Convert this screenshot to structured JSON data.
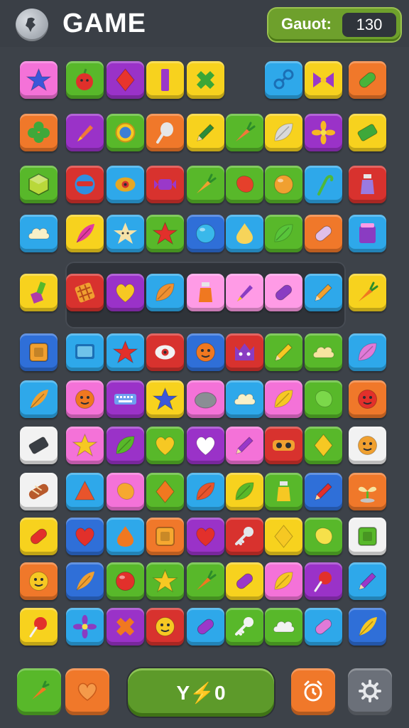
{
  "header": {
    "title": "GAME",
    "score_label": "Gauot:",
    "score_value": "130",
    "globe_icon": "globe-icon"
  },
  "colors": {
    "pink": "#f472d8",
    "green": "#58b82a",
    "purple": "#9a32c8",
    "yellow": "#f7d21e",
    "sky": "#2ea8ea",
    "orange": "#f0782a",
    "red": "#d8322e",
    "white": "#f2f2f2",
    "blue": "#2f6fd8",
    "lightpink": "#ff9be6"
  },
  "grid": {
    "rows": [
      [
        {
          "c": "pink",
          "icon": "star",
          "ic": "#3b57d9"
        },
        {
          "c": "green",
          "icon": "apple",
          "ic": "#e0302b"
        },
        {
          "c": "purple",
          "icon": "diamond",
          "ic": "#e8342c"
        },
        {
          "c": "yellow",
          "icon": "bar",
          "ic": "#9a38c9"
        },
        {
          "c": "yellow",
          "icon": "cross",
          "ic": "#3aa637"
        },
        {
          "c": "none"
        },
        {
          "c": "sky",
          "icon": "chain",
          "ic": "#1b6fb5"
        },
        {
          "c": "yellow",
          "icon": "bowtie",
          "ic": "#9a38c9"
        },
        {
          "c": "orange",
          "icon": "capsule",
          "ic": "#48b33a"
        }
      ],
      [
        {
          "c": "orange",
          "icon": "clover",
          "ic": "#3fa83a"
        },
        {
          "c": "purple",
          "icon": "brush",
          "ic": "#f0783a"
        },
        {
          "c": "green",
          "icon": "coin",
          "ic": "#3c7fd6"
        },
        {
          "c": "orange",
          "icon": "spoon",
          "ic": "#e6e6e6"
        },
        {
          "c": "yellow",
          "icon": "pencil",
          "ic": "#2c8c3a"
        },
        {
          "c": "green",
          "icon": "carrot",
          "ic": "#f0783a"
        },
        {
          "c": "yellow",
          "icon": "leaf",
          "ic": "#d9d9d9"
        },
        {
          "c": "purple",
          "icon": "flower",
          "ic": "#f6b823"
        },
        {
          "c": "yellow",
          "icon": "eraser",
          "ic": "#3fa83a"
        }
      ],
      [
        {
          "c": "green",
          "icon": "cube",
          "ic": "#b9d83a"
        },
        {
          "c": "red",
          "icon": "mask",
          "ic": "#2f8fe0"
        },
        {
          "c": "sky",
          "icon": "eye",
          "ic": "#e5a724"
        },
        {
          "c": "red",
          "icon": "candy",
          "ic": "#9a38c9"
        },
        {
          "c": "green",
          "icon": "carrot",
          "ic": "#f0a030"
        },
        {
          "c": "green",
          "icon": "blob",
          "ic": "#e5402b"
        },
        {
          "c": "green",
          "icon": "ball",
          "ic": "#f0a030"
        },
        {
          "c": "sky",
          "icon": "cane",
          "ic": "#4fb83a"
        },
        {
          "c": "red",
          "icon": "bottle",
          "ic": "#9a7ae0"
        }
      ],
      [
        {
          "c": "sky",
          "icon": "cloud",
          "ic": "#f8f0c8"
        },
        {
          "c": "yellow",
          "icon": "feather",
          "ic": "#e23aa0"
        },
        {
          "c": "sky",
          "icon": "starface",
          "ic": "#f5e2a8"
        },
        {
          "c": "green",
          "icon": "star",
          "ic": "#e2302b"
        },
        {
          "c": "blue",
          "icon": "ball",
          "ic": "#39b8ea"
        },
        {
          "c": "sky",
          "icon": "drop",
          "ic": "#f6d45a"
        },
        {
          "c": "green",
          "icon": "leaf",
          "ic": "#58c53a"
        },
        {
          "c": "orange",
          "icon": "capsule",
          "ic": "#e0bfe8"
        },
        {
          "c": "sky",
          "icon": "jar",
          "ic": "#8a3cc2"
        }
      ],
      [
        {
          "c": "yellow",
          "icon": "paint",
          "ic": "#b03ca8"
        },
        {
          "c": "red",
          "icon": "waffle",
          "ic": "#f0a030"
        },
        {
          "c": "purple",
          "icon": "heart",
          "ic": "#f6c823"
        },
        {
          "c": "sky",
          "icon": "leaf",
          "ic": "#f09030"
        },
        {
          "c": "lightpink",
          "icon": "bottle",
          "ic": "#f07820"
        },
        {
          "c": "lightpink",
          "icon": "brush",
          "ic": "#8a3cc2"
        },
        {
          "c": "lightpink",
          "icon": "capsule",
          "ic": "#8a3cc2"
        },
        {
          "c": "sky",
          "icon": "pencil",
          "ic": "#f0a030"
        },
        {
          "c": "yellow",
          "icon": "carrot",
          "ic": "#f07820"
        }
      ],
      [
        {
          "c": "blue",
          "icon": "box",
          "ic": "#f0a030"
        },
        {
          "c": "sky",
          "icon": "screen",
          "ic": "#6fc3ea"
        },
        {
          "c": "sky",
          "icon": "star",
          "ic": "#e2302b"
        },
        {
          "c": "red",
          "icon": "eye",
          "ic": "#f2f2f2"
        },
        {
          "c": "blue",
          "icon": "face",
          "ic": "#f07820"
        },
        {
          "c": "red",
          "icon": "monster",
          "ic": "#8a3cc2"
        },
        {
          "c": "green",
          "icon": "pencil",
          "ic": "#f6c823"
        },
        {
          "c": "green",
          "icon": "cloud",
          "ic": "#f6e4a0"
        },
        {
          "c": "sky",
          "icon": "leaf",
          "ic": "#e07ad8"
        }
      ],
      [
        {
          "c": "sky",
          "icon": "feather",
          "ic": "#f0a030"
        },
        {
          "c": "pink",
          "icon": "face",
          "ic": "#f07820"
        },
        {
          "c": "purple",
          "icon": "keyboard",
          "ic": "#6fa0f0"
        },
        {
          "c": "yellow",
          "icon": "star",
          "ic": "#3b57d9"
        },
        {
          "c": "pink",
          "icon": "stone",
          "ic": "#8a8e94"
        },
        {
          "c": "sky",
          "icon": "cloud",
          "ic": "#f8f0c8"
        },
        {
          "c": "pink",
          "icon": "leaf",
          "ic": "#f6c823"
        },
        {
          "c": "green",
          "icon": "blob",
          "ic": "#7bd84a"
        },
        {
          "c": "orange",
          "icon": "face",
          "ic": "#e2302b"
        }
      ],
      [
        {
          "c": "white",
          "icon": "eraser",
          "ic": "#3a3e44"
        },
        {
          "c": "pink",
          "icon": "star",
          "ic": "#f6c823"
        },
        {
          "c": "purple",
          "icon": "leaf",
          "ic": "#58b82a"
        },
        {
          "c": "green",
          "icon": "heart",
          "ic": "#f6c823"
        },
        {
          "c": "purple",
          "icon": "heart",
          "ic": "#ffffff"
        },
        {
          "c": "pink",
          "icon": "pencil",
          "ic": "#9a38c9"
        },
        {
          "c": "red",
          "icon": "goggles",
          "ic": "#f0a030"
        },
        {
          "c": "green",
          "icon": "diamond",
          "ic": "#f6c823"
        },
        {
          "c": "white",
          "icon": "face",
          "ic": "#f0a030"
        }
      ],
      [
        {
          "c": "white",
          "icon": "bread",
          "ic": "#b85a2c"
        },
        {
          "c": "sky",
          "icon": "cone",
          "ic": "#e8542c"
        },
        {
          "c": "pink",
          "icon": "blob",
          "ic": "#f6a830"
        },
        {
          "c": "green",
          "icon": "diamond",
          "ic": "#f07820"
        },
        {
          "c": "sky",
          "icon": "leaf",
          "ic": "#e8542c"
        },
        {
          "c": "yellow",
          "icon": "leaf",
          "ic": "#58b82a"
        },
        {
          "c": "green",
          "icon": "bottle",
          "ic": "#f6c823"
        },
        {
          "c": "blue",
          "icon": "pencil",
          "ic": "#e2302b"
        },
        {
          "c": "orange",
          "icon": "sprout",
          "ic": "#f6e4a0"
        }
      ],
      [
        {
          "c": "yellow",
          "icon": "capsule",
          "ic": "#e2302b"
        },
        {
          "c": "blue",
          "icon": "heart",
          "ic": "#e2302b"
        },
        {
          "c": "sky",
          "icon": "drop",
          "ic": "#f07820"
        },
        {
          "c": "orange",
          "icon": "box",
          "ic": "#f6a830"
        },
        {
          "c": "purple",
          "icon": "heart",
          "ic": "#e2302b"
        },
        {
          "c": "red",
          "icon": "key",
          "ic": "#e2e6ea"
        },
        {
          "c": "yellow",
          "icon": "diamond",
          "ic": "#f6c823"
        },
        {
          "c": "green",
          "icon": "blob",
          "ic": "#f6e04a"
        },
        {
          "c": "white",
          "icon": "box",
          "ic": "#58b82a"
        }
      ],
      [
        {
          "c": "orange",
          "icon": "face",
          "ic": "#f6c823"
        },
        {
          "c": "blue",
          "icon": "feather",
          "ic": "#f0a030"
        },
        {
          "c": "green",
          "icon": "ball",
          "ic": "#e2302b"
        },
        {
          "c": "green",
          "icon": "star",
          "ic": "#f6c823"
        },
        {
          "c": "green",
          "icon": "carrot",
          "ic": "#f07820"
        },
        {
          "c": "yellow",
          "icon": "capsule",
          "ic": "#9a38c9"
        },
        {
          "c": "pink",
          "icon": "leaf",
          "ic": "#f6c823"
        },
        {
          "c": "purple",
          "icon": "lollipop",
          "ic": "#e2302b"
        },
        {
          "c": "sky",
          "icon": "pencil",
          "ic": "#9a38c9"
        }
      ],
      [
        {
          "c": "yellow",
          "icon": "lollipop",
          "ic": "#e2302b"
        },
        {
          "c": "sky",
          "icon": "flower",
          "ic": "#8a3cc2"
        },
        {
          "c": "purple",
          "icon": "cross",
          "ic": "#f07820"
        },
        {
          "c": "red",
          "icon": "face",
          "ic": "#f6c823"
        },
        {
          "c": "sky",
          "icon": "capsule",
          "ic": "#9a38c9"
        },
        {
          "c": "green",
          "icon": "key",
          "ic": "#f2f2f2"
        },
        {
          "c": "green",
          "icon": "cloud",
          "ic": "#f2f2f2"
        },
        {
          "c": "sky",
          "icon": "capsule",
          "ic": "#e07ad8"
        },
        {
          "c": "blue",
          "icon": "feather",
          "ic": "#f6c823"
        }
      ]
    ]
  },
  "bottom_bar": {
    "left_button_icon": "carrot-icon",
    "heart_button_icon": "heart-icon",
    "center_label": "Y⚡0",
    "timer_button_icon": "alarm-clock-icon",
    "settings_button_icon": "gear-icon"
  }
}
